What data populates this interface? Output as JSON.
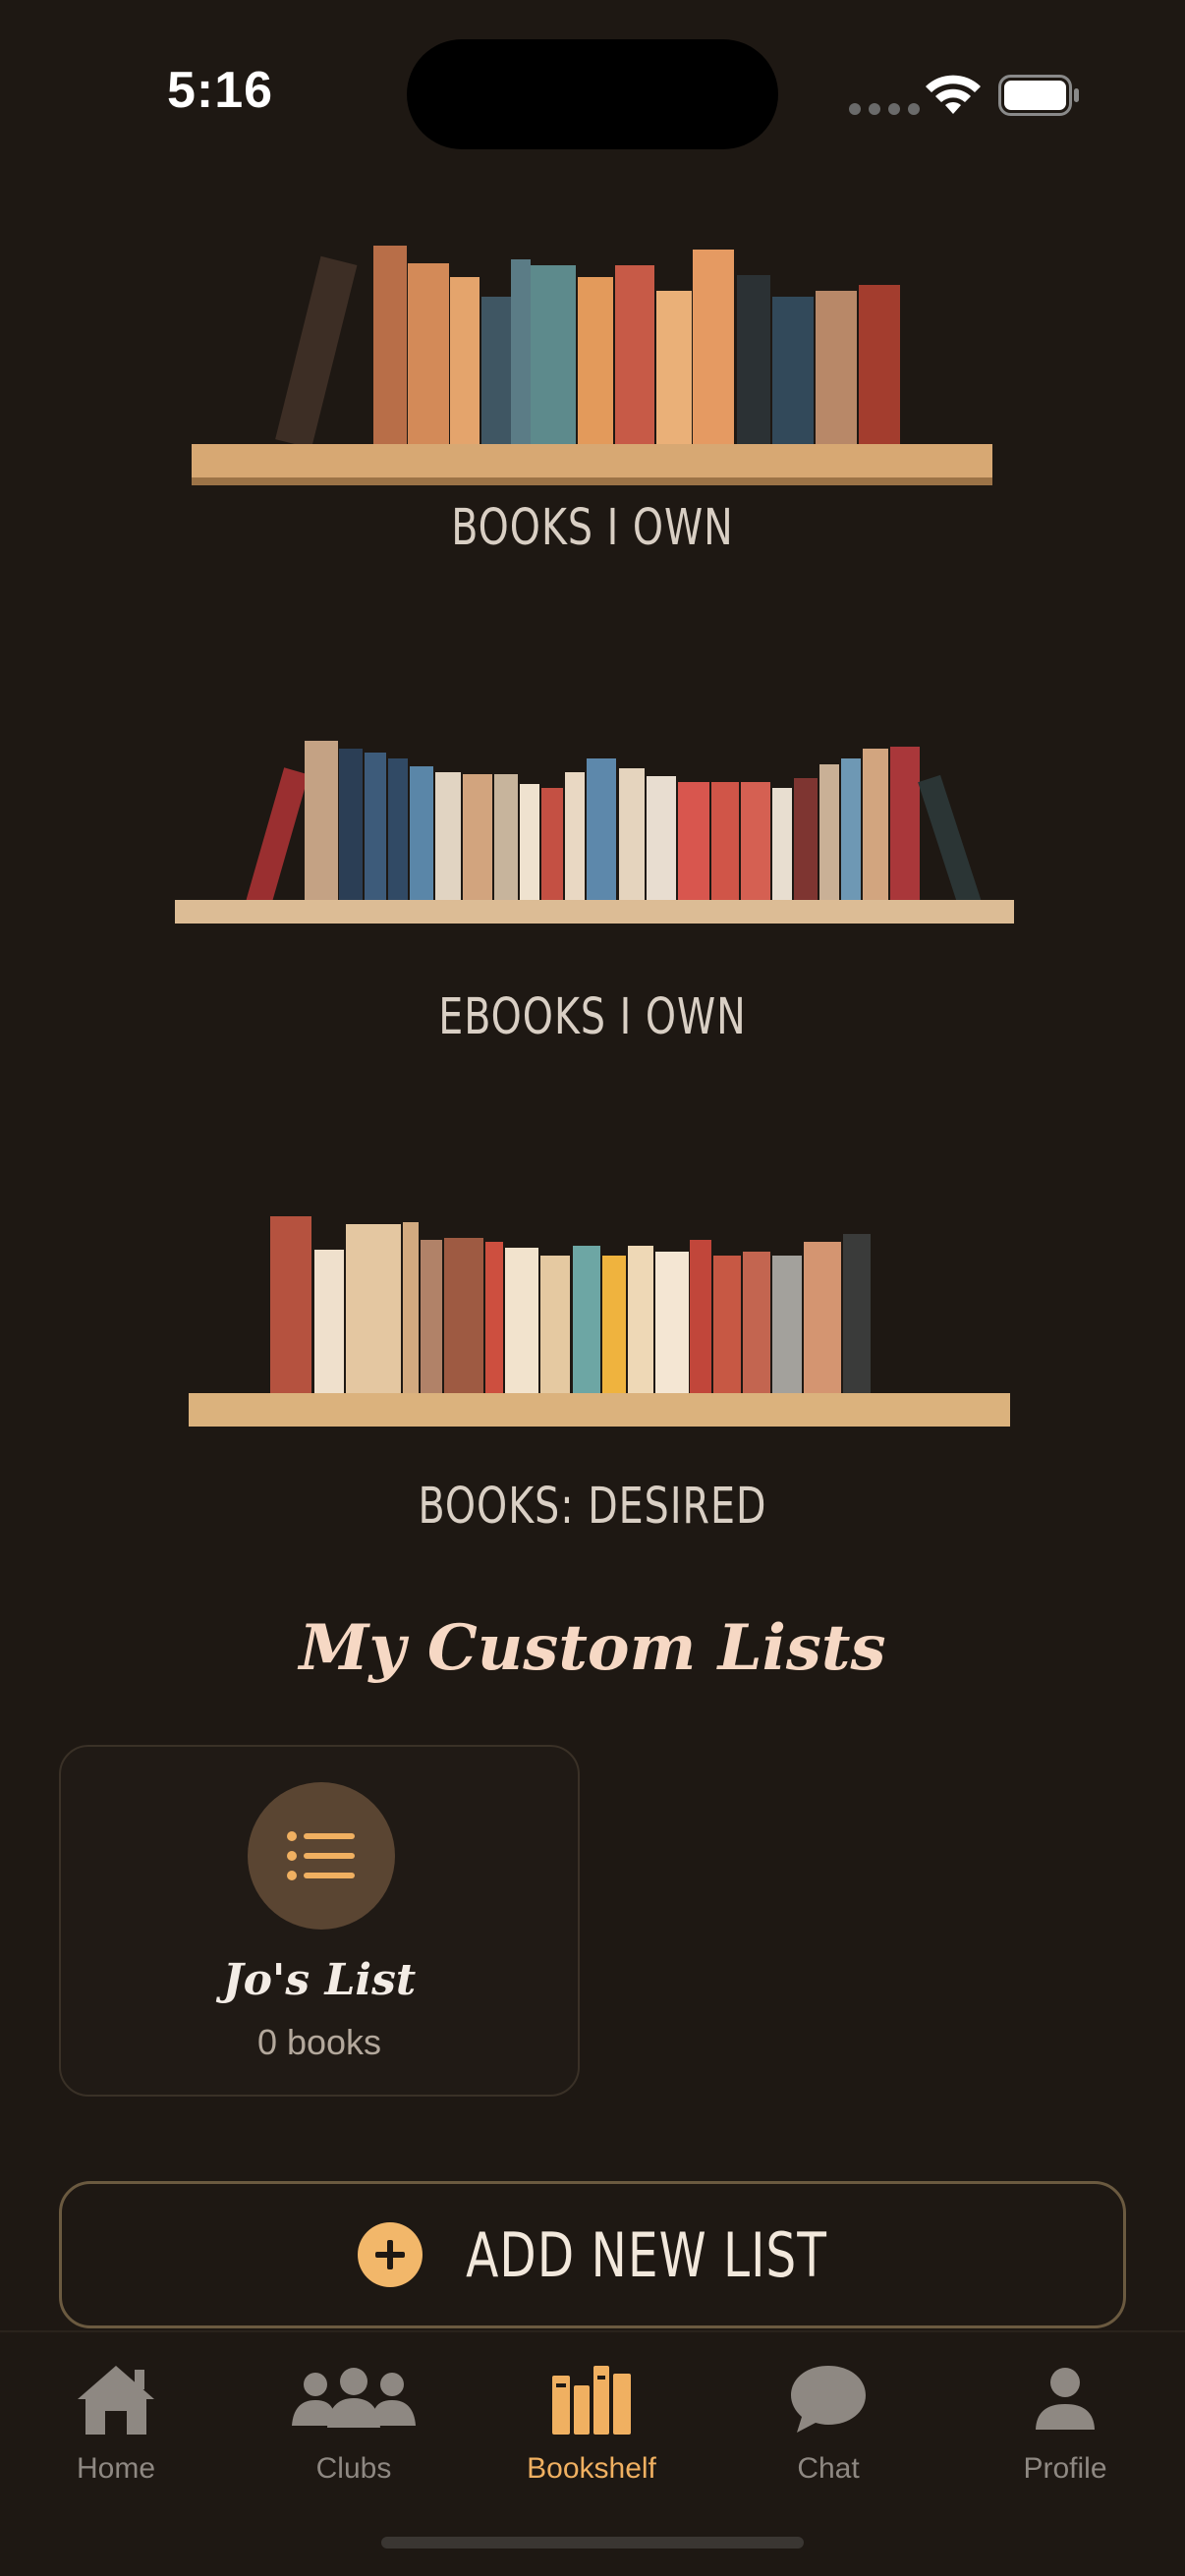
{
  "status_bar": {
    "time": "5:16"
  },
  "shelves": [
    {
      "label": "BOOKS I OWN"
    },
    {
      "label": "EBOOKS I OWN"
    },
    {
      "label": "BOOKS: DESIRED"
    }
  ],
  "custom_lists": {
    "title": "My Custom Lists",
    "lists": [
      {
        "name": "Jo's List",
        "count": "0 books"
      }
    ],
    "add_label": "ADD NEW LIST"
  },
  "tabbar": {
    "tabs": [
      {
        "label": "Home",
        "icon": "house-icon"
      },
      {
        "label": "Clubs",
        "icon": "people-icon"
      },
      {
        "label": "Bookshelf",
        "icon": "books-icon",
        "active": true
      },
      {
        "label": "Chat",
        "icon": "chat-bubble-icon"
      },
      {
        "label": "Profile",
        "icon": "person-icon"
      }
    ]
  },
  "colors": {
    "background": "#1e1813",
    "accent": "#f0b061",
    "heading": "#f6d8c4"
  }
}
